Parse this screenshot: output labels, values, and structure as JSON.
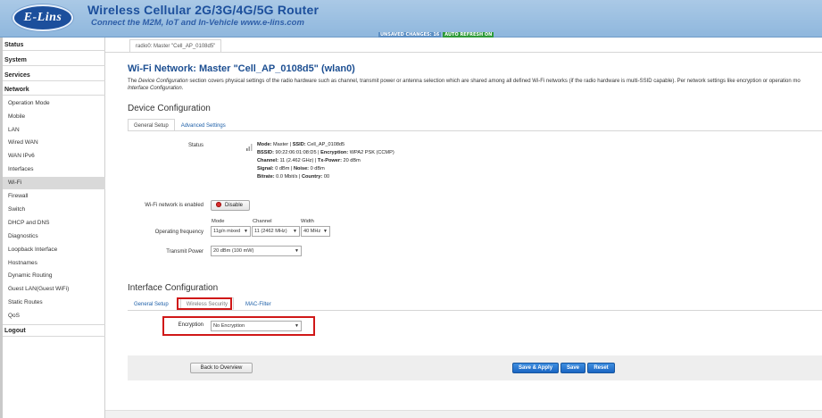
{
  "header": {
    "logo_text": "E-Lins",
    "title": "Wireless Cellular 2G/3G/4G/5G Router",
    "subtitle": "Connect the M2M, IoT and In-Vehicle www.e-lins.com",
    "badge_unsaved": "UNSAVED CHANGES: 16",
    "badge_auto": "AUTO REFRESH ON"
  },
  "sidebar": {
    "status": "Status",
    "system": "System",
    "services": "Services",
    "network": "Network",
    "items": [
      "Operation Mode",
      "Mobile",
      "LAN",
      "Wired WAN",
      "WAN IPv6",
      "Interfaces",
      "Wi-Fi",
      "Firewall",
      "Switch",
      "DHCP and DNS",
      "Diagnostics",
      "Loopback Interface",
      "Hostnames",
      "Dynamic Routing",
      "Guest LAN(Guest WiFi)",
      "Static Routes",
      "QoS"
    ],
    "active_item": "Wi-Fi",
    "logout": "Logout"
  },
  "main": {
    "breadcrumb_tab": "radio0: Master \"Cell_AP_0108d5\"",
    "title": "Wi-Fi Network: Master \"Cell_AP_0108d5\" (wlan0)",
    "description_1": "The ",
    "description_em1": "Device Configuration",
    "description_2": " section covers physical settings of the radio hardware such as channel, transmit power or antenna selection which are shared among all defined Wi-Fi networks (if the radio hardware is multi-SSID capable). Per network settings like encryption or operation mo",
    "description_em2": "Interface Configuration",
    "description_3": ".",
    "device_config": {
      "title": "Device Configuration",
      "tabs": [
        "General Setup",
        "Advanced Settings"
      ],
      "status_label": "Status",
      "status": {
        "mode_k": "Mode:",
        "mode_v": " Master | ",
        "ssid_k": "SSID:",
        "ssid_v": " Cell_AP_0108d5",
        "bssid_k": "BSSID:",
        "bssid_v": " 90:22:06:01:08:D5 | ",
        "enc_k": "Encryption:",
        "enc_v": " WPA2 PSK (CCMP)",
        "channel_k": "Channel:",
        "channel_v": " 11 (2.462 GHz) | ",
        "txp_k": "Tx-Power:",
        "txp_v": " 20 dBm",
        "signal_k": "Signal:",
        "signal_v": " 0 dBm | ",
        "noise_k": "Noise:",
        "noise_v": " 0 dBm",
        "bitrate_k": "Bitrate:",
        "bitrate_v": " 0.0 Mbit/s | ",
        "country_k": "Country:",
        "country_v": " 00"
      },
      "enabled_label": "Wi-Fi network is enabled",
      "disable_button": "Disable",
      "op_freq_label": "Operating frequency",
      "mode_caption": "Mode",
      "channel_caption": "Channel",
      "width_caption": "Width",
      "mode_value": "11g/n mixed",
      "channel_value": "11 (2462 MHz)",
      "width_value": "40 MHz",
      "tx_power_label": "Transmit Power",
      "tx_power_value": "20 dBm (100 mW)"
    },
    "iface_config": {
      "title": "Interface Configuration",
      "tabs": [
        "General Setup",
        "Wireless Security",
        "MAC-Filter"
      ],
      "encryption_label": "Encryption",
      "encryption_value": "No Encryption"
    },
    "buttons": {
      "back": "Back to Overview",
      "save_apply": "Save & Apply",
      "save": "Save",
      "reset": "Reset"
    }
  },
  "colors": {
    "header_bg": "#9fc2e3",
    "brand": "#1c4f9c",
    "link": "#1d5fa8",
    "primary_button": "#2474d0",
    "highlight": "#d01818"
  }
}
